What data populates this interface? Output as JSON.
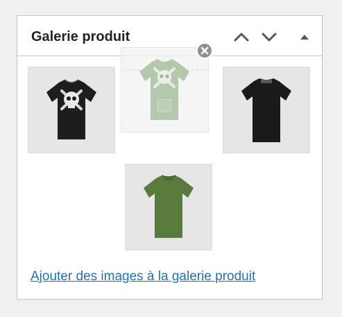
{
  "metabox": {
    "title": "Galerie produit",
    "move_up_label": "",
    "move_down_label": "",
    "toggle_label": "",
    "icons": {
      "move_up": "chevron-up-icon",
      "move_down": "chevron-down-icon",
      "toggle": "triangle-up-icon",
      "remove": "close-circle-icon"
    }
  },
  "gallery": {
    "images": [
      {
        "name": "black-tshirt-skull-front",
        "color": "#1a1a1a",
        "graphic": "skull-crossbones"
      },
      {
        "name": "sage-tshirt-skull-front",
        "color": "#9fb896",
        "graphic": "skull-crossbones",
        "state": "dragging"
      },
      {
        "name": "black-tshirt-back",
        "color": "#1a1a1a",
        "graphic": "neck-label"
      },
      {
        "name": "green-tshirt-back",
        "color": "#5a7a3e",
        "graphic": "none"
      }
    ]
  },
  "actions": {
    "add_images_label": "Ajouter des images à la galerie produit"
  },
  "colors": {
    "link": "#2271b1",
    "title": "#1d2327",
    "border": "#c3c4c7",
    "background": "#f0f0f1"
  }
}
